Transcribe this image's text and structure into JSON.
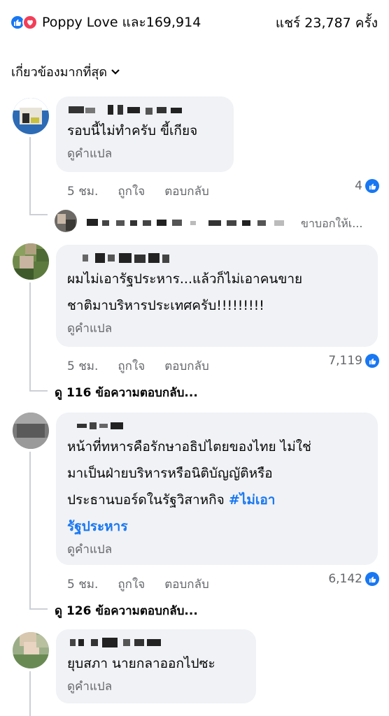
{
  "header": {
    "reaction_text": "Poppy Love และ169,914",
    "shares_text": "แชร์ 23,787 ครั้ง",
    "sort_label": "เกี่ยวข้องมากที่สุด"
  },
  "comments": [
    {
      "text_lines": [
        "รอบนี้ไม่ทำครับ ขี้เกียจ"
      ],
      "translate": "ดูคำแปล",
      "time": "5 ชม.",
      "like_label": "ถูกใจ",
      "reply_label": "ตอบกลับ",
      "reaction_count": "4",
      "reply_preview": "ขาบอกให้เ..."
    },
    {
      "text_lines": [
        "ผมไม่เอารัฐประหาร...แล้วก็ไม่เอาคนขาย",
        "ชาติมาบริหารประเทศครับ!!!!!!!!!"
      ],
      "translate": "ดูคำแปล",
      "time": "5 ชม.",
      "like_label": "ถูกใจ",
      "reply_label": "ตอบกลับ",
      "reaction_count": "7,119",
      "view_replies": "ดู 116 ข้อความตอบกลับ..."
    },
    {
      "text_lines": [
        "หน้าที่ทหารคือรักษาอธิปไตยของไทย ไม่ใช่",
        "มาเป็นฝ่ายบริหารหรือนิติบัญญัติหรือ",
        "ประธานบอร์ดในรัฐวิสาหกิจ"
      ],
      "hashtag_part1": "#ไม่เอา",
      "hashtag_part2": "รัฐประหาร",
      "translate": "ดูคำแปล",
      "time": "5 ชม.",
      "like_label": "ถูกใจ",
      "reply_label": "ตอบกลับ",
      "reaction_count": "6,142",
      "view_replies": "ดู 126 ข้อความตอบกลับ..."
    },
    {
      "text_lines": [
        "ยุบสภา นายกลาออกไปซะ"
      ],
      "translate": "ดูคำแปล"
    }
  ],
  "colors": {
    "accent": "#1877f2",
    "love": "#f33e58",
    "bubble": "#f0f2f5",
    "secondary_text": "#65676b"
  }
}
